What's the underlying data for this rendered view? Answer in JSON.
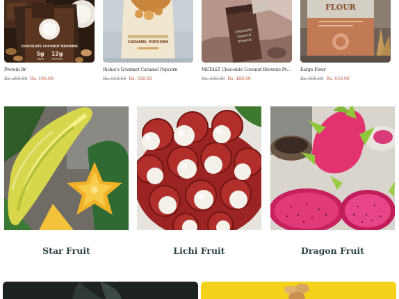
{
  "products": [
    {
      "name": "Protein Br",
      "old_price": "Rs. 260.00",
      "new_price": "Rs. 190.00",
      "package_text": {
        "title": "CHOCOLATE COCONUT BROWNIE",
        "stat1": "5g",
        "stat1_label": "FIBER",
        "stat2": "12g",
        "stat2_label": "PROTEIN"
      }
    },
    {
      "name": "Richie's Gourmet Caramel Popcorn",
      "old_price": "Rs. 550.00",
      "new_price": "Rs. 500.00",
      "package_text": {
        "title": "CARAMEL POPCORN"
      }
    },
    {
      "name": "METAST Chocolate Coconut Brownie Protei...",
      "old_price": "Rs. 500.00",
      "new_price": "Rs. 488.00",
      "package_text": {
        "line1": "chocolate",
        "line2": "coconut",
        "line3": "brownie"
      }
    },
    {
      "name": "Earge Flour",
      "old_price": "Rs. 699.00",
      "new_price": "Rs. 650.00",
      "package_text": {
        "title": "FLOUR"
      }
    }
  ],
  "fruits": [
    {
      "label": "Star Fruit"
    },
    {
      "label": "Lichi Fruit"
    },
    {
      "label": "Dragon Fruit"
    }
  ],
  "colors": {
    "price_sale": "#c0563a",
    "price_old": "#8d8d8d",
    "fruit_label": "#2c4346",
    "banner_yellow": "#f4d21b",
    "banner_dark": "#1c2320"
  }
}
